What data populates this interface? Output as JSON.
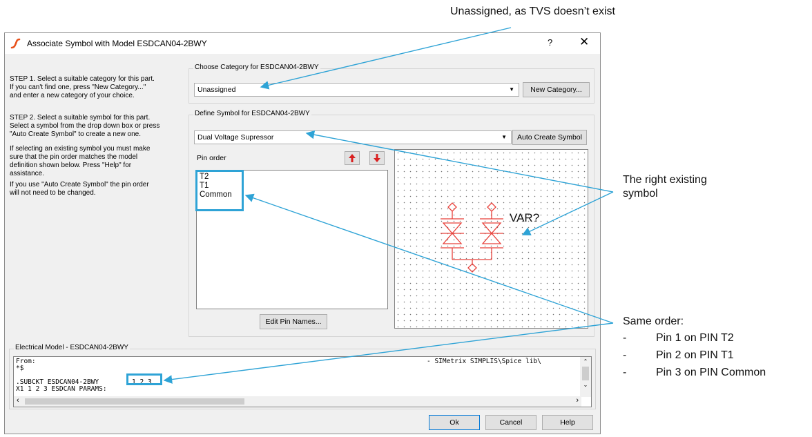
{
  "annotations": {
    "top": "Unassigned, as TVS doesn’t exist",
    "symbol_line1": "The right existing",
    "symbol_line2": "symbol",
    "order_title": "Same order:",
    "order_items": [
      {
        "dash": "-",
        "text": "Pin 1 on PIN T2"
      },
      {
        "dash": "-",
        "text": "Pin 2 on PIN T1"
      },
      {
        "dash": "-",
        "text": "Pin 3 on PIN Common"
      }
    ]
  },
  "dialog": {
    "title": "Associate Symbol with Model ESDCAN04-2BWY",
    "help_glyph": "?",
    "close_glyph": "✕"
  },
  "steps": {
    "step1": [
      "STEP 1. Select a suitable category for this part.",
      "If you can't find one, press \"New Category...\"",
      "and enter a new category of your choice."
    ],
    "step2": [
      "STEP 2. Select a suitable symbol for this part.",
      "Select a symbol from the drop down box or press",
      "\"Auto Create Symbol\" to create a new one."
    ],
    "step3": [
      "If selecting an existing symbol you must make",
      "sure that the pin order matches the model",
      "definition shown below. Press \"Help\" for",
      "assistance."
    ],
    "step4": [
      "If you use \"Auto Create Symbol\" the pin order",
      "will not need to be changed."
    ]
  },
  "category": {
    "group_title": "Choose Category for ESDCAN04-2BWY",
    "selected": "Unassigned",
    "new_button": "New Category..."
  },
  "symbol": {
    "group_title": "Define Symbol for ESDCAN04-2BWY",
    "selected": "Dual Voltage Supressor",
    "auto_button": "Auto Create Symbol",
    "pin_order_label": "Pin order",
    "pins": [
      "T2",
      "T1",
      "Common"
    ],
    "edit_button": "Edit Pin Names...",
    "preview_label": "VAR?"
  },
  "model": {
    "group_title": "Electrical Model - ESDCAN04-2BWY",
    "lines": [
      "From:",
      "*$",
      "",
      ".SUBCKT ESDCAN04-2BWY",
      "X1 1 2 3 ESDCAN PARAMS:"
    ],
    "pin_numbers": "1 2 3",
    "path_text": "- SIMetrix SIMPLIS\\Spice lib\\"
  },
  "buttons": {
    "ok": "Ok",
    "cancel": "Cancel",
    "help": "Help"
  },
  "colors": {
    "accent": "#2ea3d6",
    "symbol": "#e8403a",
    "arrow_red": "#d92020"
  }
}
